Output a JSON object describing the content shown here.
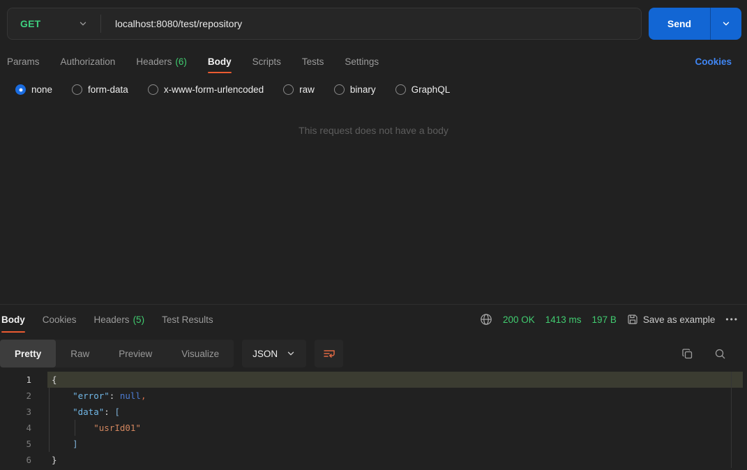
{
  "colors": {
    "accent_orange": "#EA5B31",
    "method_green": "#3ECF7E",
    "status_green": "#41CC70",
    "send_blue": "#1266D4",
    "link_blue": "#4086F4",
    "active_line_bg": "#3B3C31"
  },
  "request": {
    "method": "GET",
    "url": "localhost:8080/test/repository",
    "send_label": "Send",
    "cookies_link": "Cookies",
    "tabs": [
      {
        "label": "Params"
      },
      {
        "label": "Authorization"
      },
      {
        "label": "Headers",
        "count": "(6)"
      },
      {
        "label": "Body",
        "active": true
      },
      {
        "label": "Scripts"
      },
      {
        "label": "Tests"
      },
      {
        "label": "Settings"
      }
    ],
    "body_modes": [
      {
        "label": "none",
        "selected": true
      },
      {
        "label": "form-data"
      },
      {
        "label": "x-www-form-urlencoded"
      },
      {
        "label": "raw"
      },
      {
        "label": "binary"
      },
      {
        "label": "GraphQL"
      }
    ],
    "empty_message": "This request does not have a body"
  },
  "response": {
    "tabs": [
      {
        "label": "Body",
        "active": true
      },
      {
        "label": "Cookies"
      },
      {
        "label": "Headers",
        "count": "(5)"
      },
      {
        "label": "Test Results"
      }
    ],
    "status_code": "200 OK",
    "time": "1413 ms",
    "size": "197 B",
    "save_as_example": "Save as example",
    "more_label": "•••",
    "view_tabs": [
      {
        "label": "Pretty",
        "active": true
      },
      {
        "label": "Raw"
      },
      {
        "label": "Preview"
      },
      {
        "label": "Visualize"
      }
    ],
    "format": "JSON",
    "code_lines": [
      {
        "num": "1",
        "active": true,
        "tokens": [
          {
            "text": "{",
            "type": "punct"
          }
        ]
      },
      {
        "num": "2",
        "tokens": [
          {
            "text": "    ",
            "type": "ws"
          },
          {
            "text": "\"error\"",
            "type": "key"
          },
          {
            "text": ":",
            "type": "punct"
          },
          {
            "text": " ",
            "type": "ws"
          },
          {
            "text": "null",
            "type": "atom"
          },
          {
            "text": ",",
            "type": "comma"
          }
        ]
      },
      {
        "num": "3",
        "tokens": [
          {
            "text": "    ",
            "type": "ws"
          },
          {
            "text": "\"data\"",
            "type": "key"
          },
          {
            "text": ":",
            "type": "punct"
          },
          {
            "text": " ",
            "type": "ws"
          },
          {
            "text": "[",
            "type": "bracket"
          }
        ]
      },
      {
        "num": "4",
        "tokens": [
          {
            "text": "        ",
            "type": "ws"
          },
          {
            "text": "\"usrId01\"",
            "type": "string"
          }
        ]
      },
      {
        "num": "5",
        "tokens": [
          {
            "text": "    ",
            "type": "ws"
          },
          {
            "text": "]",
            "type": "bracket"
          }
        ]
      },
      {
        "num": "6",
        "tokens": [
          {
            "text": "}",
            "type": "punct"
          }
        ]
      }
    ]
  }
}
